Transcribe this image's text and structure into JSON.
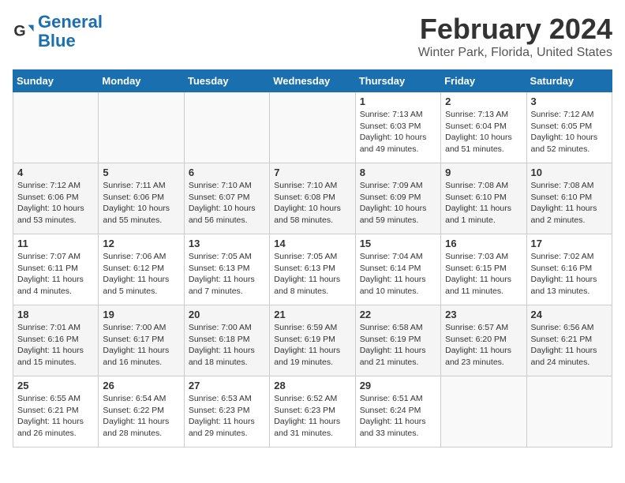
{
  "header": {
    "logo_general": "General",
    "logo_blue": "Blue",
    "title": "February 2024",
    "subtitle": "Winter Park, Florida, United States"
  },
  "weekdays": [
    "Sunday",
    "Monday",
    "Tuesday",
    "Wednesday",
    "Thursday",
    "Friday",
    "Saturday"
  ],
  "weeks": [
    [
      {
        "day": "",
        "info": ""
      },
      {
        "day": "",
        "info": ""
      },
      {
        "day": "",
        "info": ""
      },
      {
        "day": "",
        "info": ""
      },
      {
        "day": "1",
        "info": "Sunrise: 7:13 AM\nSunset: 6:03 PM\nDaylight: 10 hours\nand 49 minutes."
      },
      {
        "day": "2",
        "info": "Sunrise: 7:13 AM\nSunset: 6:04 PM\nDaylight: 10 hours\nand 51 minutes."
      },
      {
        "day": "3",
        "info": "Sunrise: 7:12 AM\nSunset: 6:05 PM\nDaylight: 10 hours\nand 52 minutes."
      }
    ],
    [
      {
        "day": "4",
        "info": "Sunrise: 7:12 AM\nSunset: 6:06 PM\nDaylight: 10 hours\nand 53 minutes."
      },
      {
        "day": "5",
        "info": "Sunrise: 7:11 AM\nSunset: 6:06 PM\nDaylight: 10 hours\nand 55 minutes."
      },
      {
        "day": "6",
        "info": "Sunrise: 7:10 AM\nSunset: 6:07 PM\nDaylight: 10 hours\nand 56 minutes."
      },
      {
        "day": "7",
        "info": "Sunrise: 7:10 AM\nSunset: 6:08 PM\nDaylight: 10 hours\nand 58 minutes."
      },
      {
        "day": "8",
        "info": "Sunrise: 7:09 AM\nSunset: 6:09 PM\nDaylight: 10 hours\nand 59 minutes."
      },
      {
        "day": "9",
        "info": "Sunrise: 7:08 AM\nSunset: 6:10 PM\nDaylight: 11 hours\nand 1 minute."
      },
      {
        "day": "10",
        "info": "Sunrise: 7:08 AM\nSunset: 6:10 PM\nDaylight: 11 hours\nand 2 minutes."
      }
    ],
    [
      {
        "day": "11",
        "info": "Sunrise: 7:07 AM\nSunset: 6:11 PM\nDaylight: 11 hours\nand 4 minutes."
      },
      {
        "day": "12",
        "info": "Sunrise: 7:06 AM\nSunset: 6:12 PM\nDaylight: 11 hours\nand 5 minutes."
      },
      {
        "day": "13",
        "info": "Sunrise: 7:05 AM\nSunset: 6:13 PM\nDaylight: 11 hours\nand 7 minutes."
      },
      {
        "day": "14",
        "info": "Sunrise: 7:05 AM\nSunset: 6:13 PM\nDaylight: 11 hours\nand 8 minutes."
      },
      {
        "day": "15",
        "info": "Sunrise: 7:04 AM\nSunset: 6:14 PM\nDaylight: 11 hours\nand 10 minutes."
      },
      {
        "day": "16",
        "info": "Sunrise: 7:03 AM\nSunset: 6:15 PM\nDaylight: 11 hours\nand 11 minutes."
      },
      {
        "day": "17",
        "info": "Sunrise: 7:02 AM\nSunset: 6:16 PM\nDaylight: 11 hours\nand 13 minutes."
      }
    ],
    [
      {
        "day": "18",
        "info": "Sunrise: 7:01 AM\nSunset: 6:16 PM\nDaylight: 11 hours\nand 15 minutes."
      },
      {
        "day": "19",
        "info": "Sunrise: 7:00 AM\nSunset: 6:17 PM\nDaylight: 11 hours\nand 16 minutes."
      },
      {
        "day": "20",
        "info": "Sunrise: 7:00 AM\nSunset: 6:18 PM\nDaylight: 11 hours\nand 18 minutes."
      },
      {
        "day": "21",
        "info": "Sunrise: 6:59 AM\nSunset: 6:19 PM\nDaylight: 11 hours\nand 19 minutes."
      },
      {
        "day": "22",
        "info": "Sunrise: 6:58 AM\nSunset: 6:19 PM\nDaylight: 11 hours\nand 21 minutes."
      },
      {
        "day": "23",
        "info": "Sunrise: 6:57 AM\nSunset: 6:20 PM\nDaylight: 11 hours\nand 23 minutes."
      },
      {
        "day": "24",
        "info": "Sunrise: 6:56 AM\nSunset: 6:21 PM\nDaylight: 11 hours\nand 24 minutes."
      }
    ],
    [
      {
        "day": "25",
        "info": "Sunrise: 6:55 AM\nSunset: 6:21 PM\nDaylight: 11 hours\nand 26 minutes."
      },
      {
        "day": "26",
        "info": "Sunrise: 6:54 AM\nSunset: 6:22 PM\nDaylight: 11 hours\nand 28 minutes."
      },
      {
        "day": "27",
        "info": "Sunrise: 6:53 AM\nSunset: 6:23 PM\nDaylight: 11 hours\nand 29 minutes."
      },
      {
        "day": "28",
        "info": "Sunrise: 6:52 AM\nSunset: 6:23 PM\nDaylight: 11 hours\nand 31 minutes."
      },
      {
        "day": "29",
        "info": "Sunrise: 6:51 AM\nSunset: 6:24 PM\nDaylight: 11 hours\nand 33 minutes."
      },
      {
        "day": "",
        "info": ""
      },
      {
        "day": "",
        "info": ""
      }
    ]
  ]
}
